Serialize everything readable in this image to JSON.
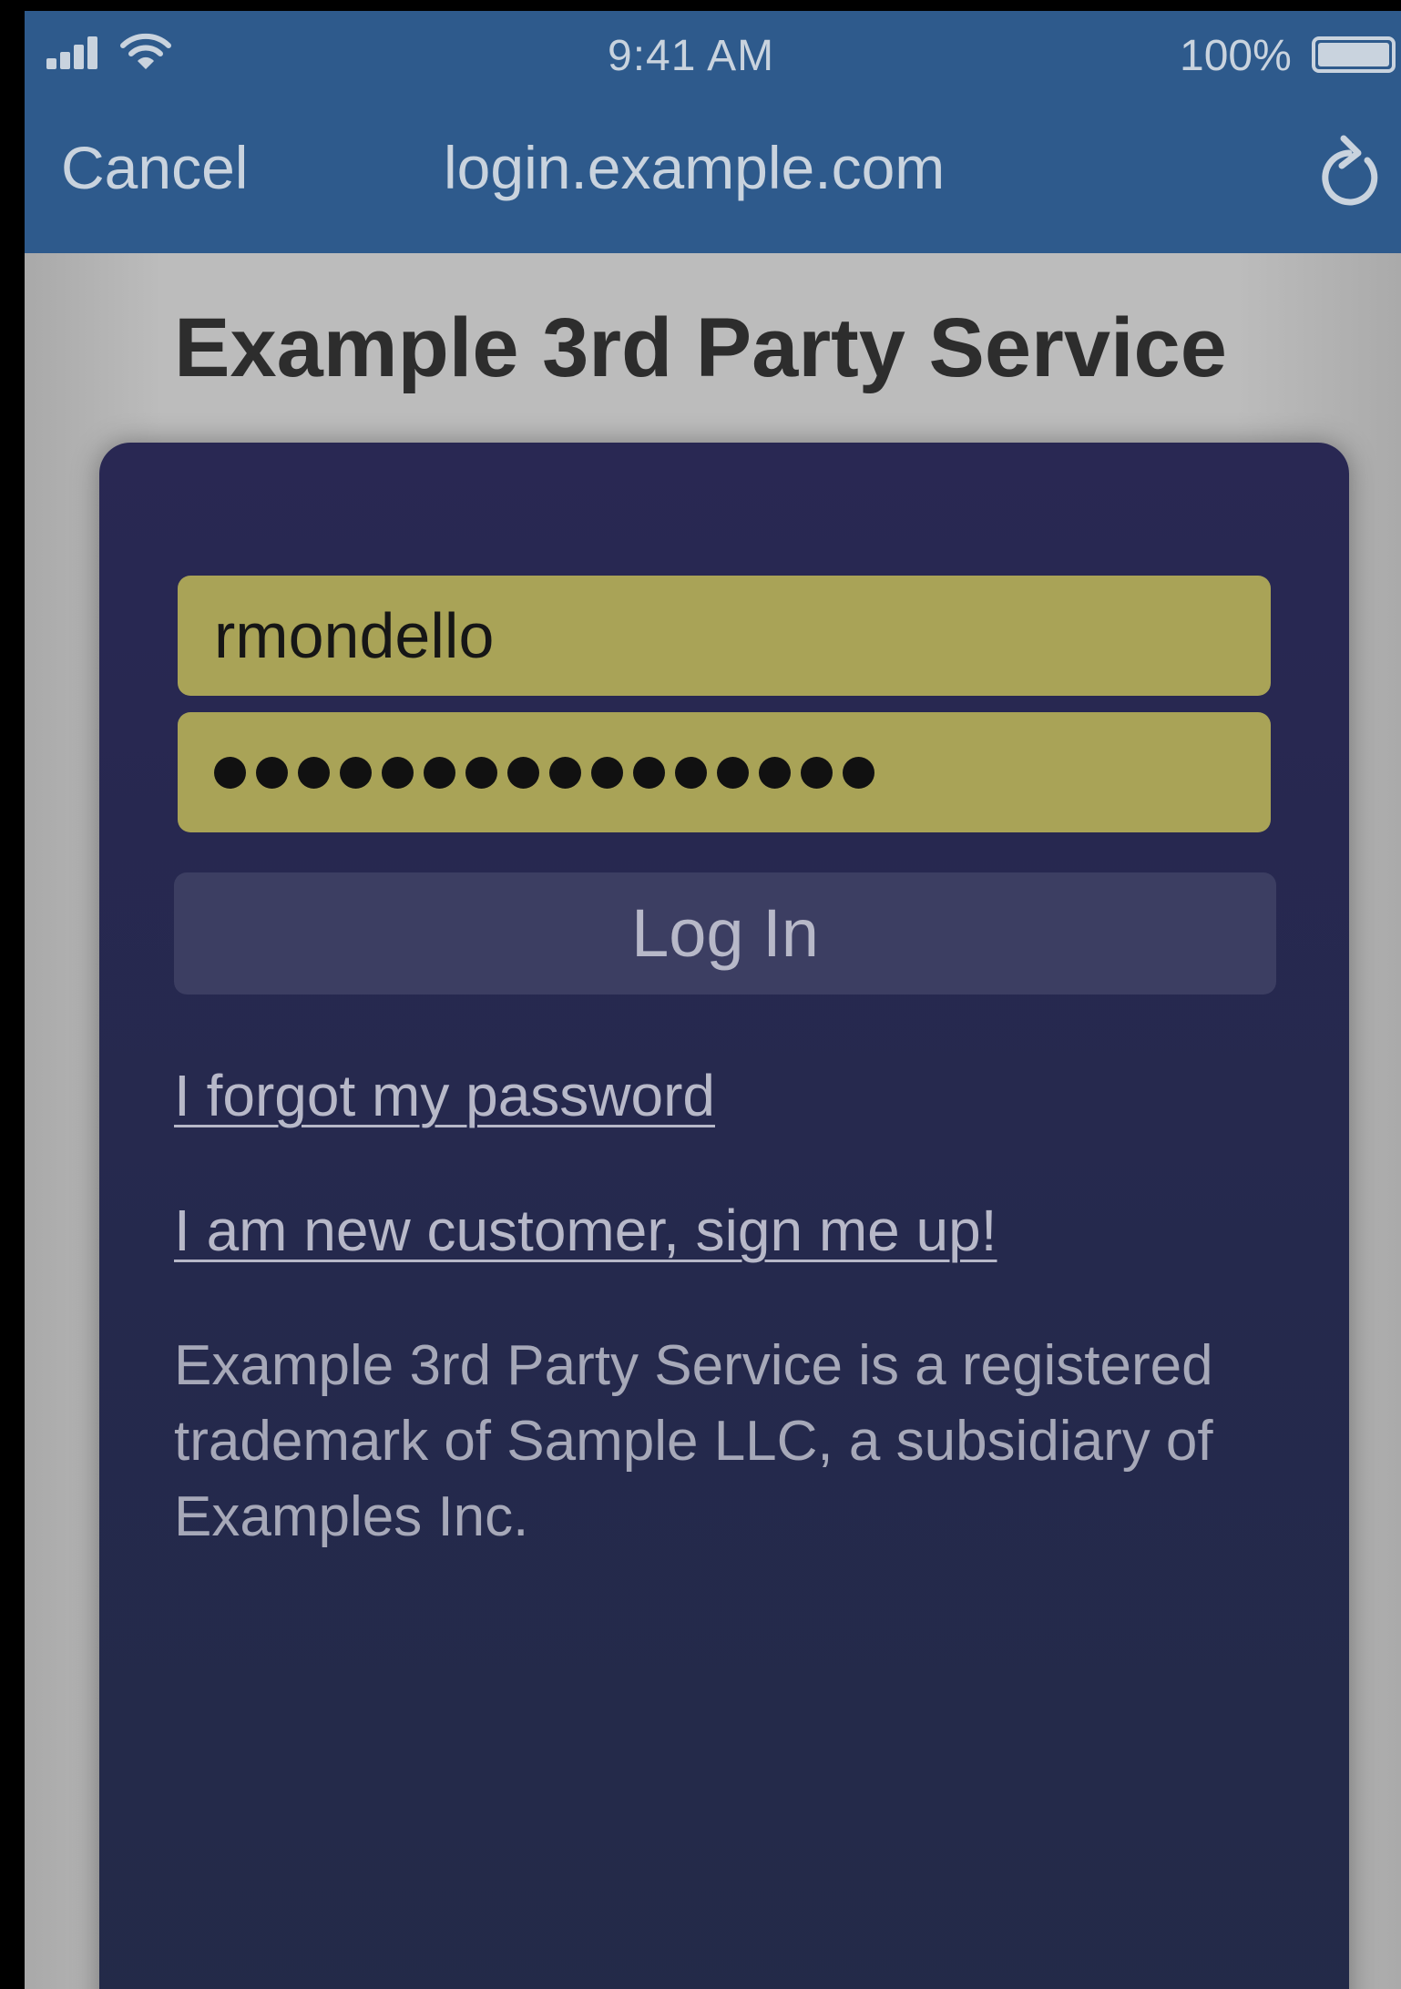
{
  "status_bar": {
    "time": "9:41 AM",
    "battery_percent": "100%",
    "battery_level": 1.0,
    "signal_icon": "signal-bars-icon",
    "wifi_icon": "wifi-icon",
    "battery_icon": "battery-icon"
  },
  "nav": {
    "cancel_label": "Cancel",
    "url": "login.example.com",
    "reload_icon": "reload-icon"
  },
  "page": {
    "title": "Example 3rd Party Service"
  },
  "form": {
    "username_value": "rmondello",
    "password_masked": "••••••••••••••••",
    "password_length": 16,
    "login_label": "Log In",
    "forgot_link": "I forgot my password",
    "signup_link": "I am new customer, sign me up!",
    "trademark_text": "Example 3rd Party Service is a registered trademark of Sample LLC, a subsidiary of Examples Inc."
  },
  "colors": {
    "top_bar": "#2e5a8c",
    "card": "#25294d",
    "autofill_field": "#a9a357",
    "button": "#3c3e62",
    "page_background": "#bcbcbc"
  }
}
